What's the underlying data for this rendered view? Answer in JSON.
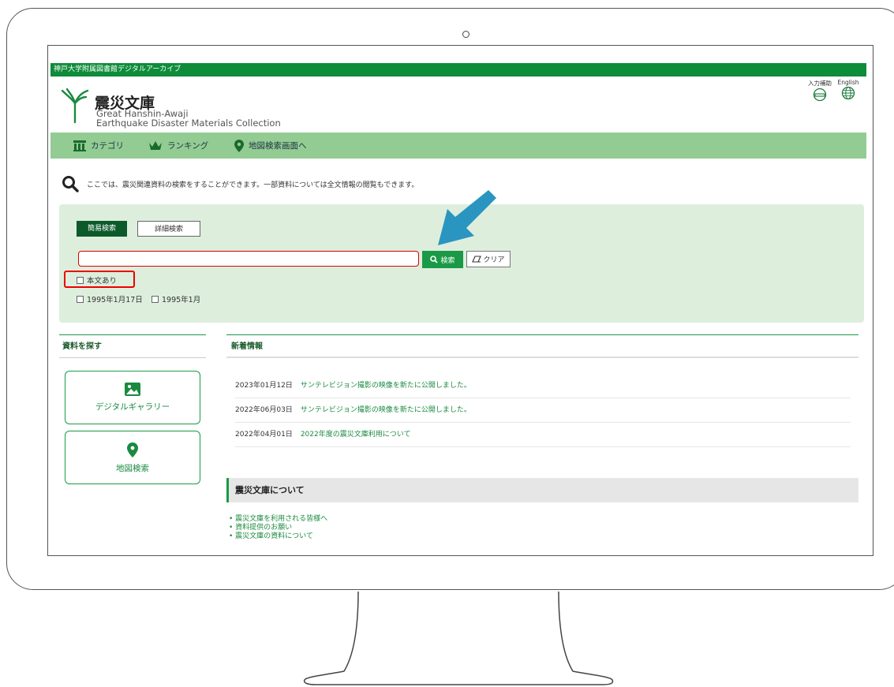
{
  "site": {
    "topbar_label": "神戸大学附属図書館デジタルアーカイブ",
    "title": "震災文庫",
    "subtitle_line1": "Great Hanshin-Awaji",
    "subtitle_line2": "Earthquake Disaster Materials Collection",
    "tools": [
      {
        "label": "入力補助",
        "icon": "input-assist-icon"
      },
      {
        "label": "English",
        "icon": "globe-icon"
      }
    ]
  },
  "nav": {
    "items": [
      {
        "label": "カテゴリ",
        "icon": "category-icon"
      },
      {
        "label": "ランキング",
        "icon": "crown-icon"
      },
      {
        "label": "地図検索画面へ",
        "icon": "map-pin-icon"
      }
    ]
  },
  "intro_text": "ここでは、震災関連資料の検索をすることができます。一部資料については全文情報の閲覧もできます。",
  "search": {
    "tab_simple": "簡易検索",
    "tab_detail": "詳細検索",
    "input_value": "",
    "search_button": "検索",
    "clear_button": "クリア",
    "checkbox_fulltext": "本文あり",
    "checkbox_date1": "1995年1月17日",
    "checkbox_date2": "1995年1月"
  },
  "sidebar": {
    "heading": "資料を探す",
    "items": [
      {
        "label": "デジタルギャラリー",
        "icon": "image-icon"
      },
      {
        "label": "地図検索",
        "icon": "map-pin-icon"
      }
    ]
  },
  "news": {
    "heading": "新着情報",
    "items": [
      {
        "date": "2023年01月12日",
        "text": "サンテレビジョン撮影の映像を新たに公開しました。"
      },
      {
        "date": "2022年06月03日",
        "text": "サンテレビジョン撮影の映像を新たに公開しました。"
      },
      {
        "date": "2022年04月01日",
        "text": "2022年度の震災文庫利用について"
      }
    ]
  },
  "about": {
    "heading": "震災文庫について",
    "links": [
      "震災文庫を利用される皆様へ",
      "資料提供のお願い",
      "震災文庫の資料について"
    ]
  },
  "colors": {
    "brand_green": "#0e8c3a",
    "nav_green": "#92cc93",
    "panel_green": "#ddeedd",
    "highlight_red": "#e00000",
    "arrow_blue": "#2a95c0"
  }
}
